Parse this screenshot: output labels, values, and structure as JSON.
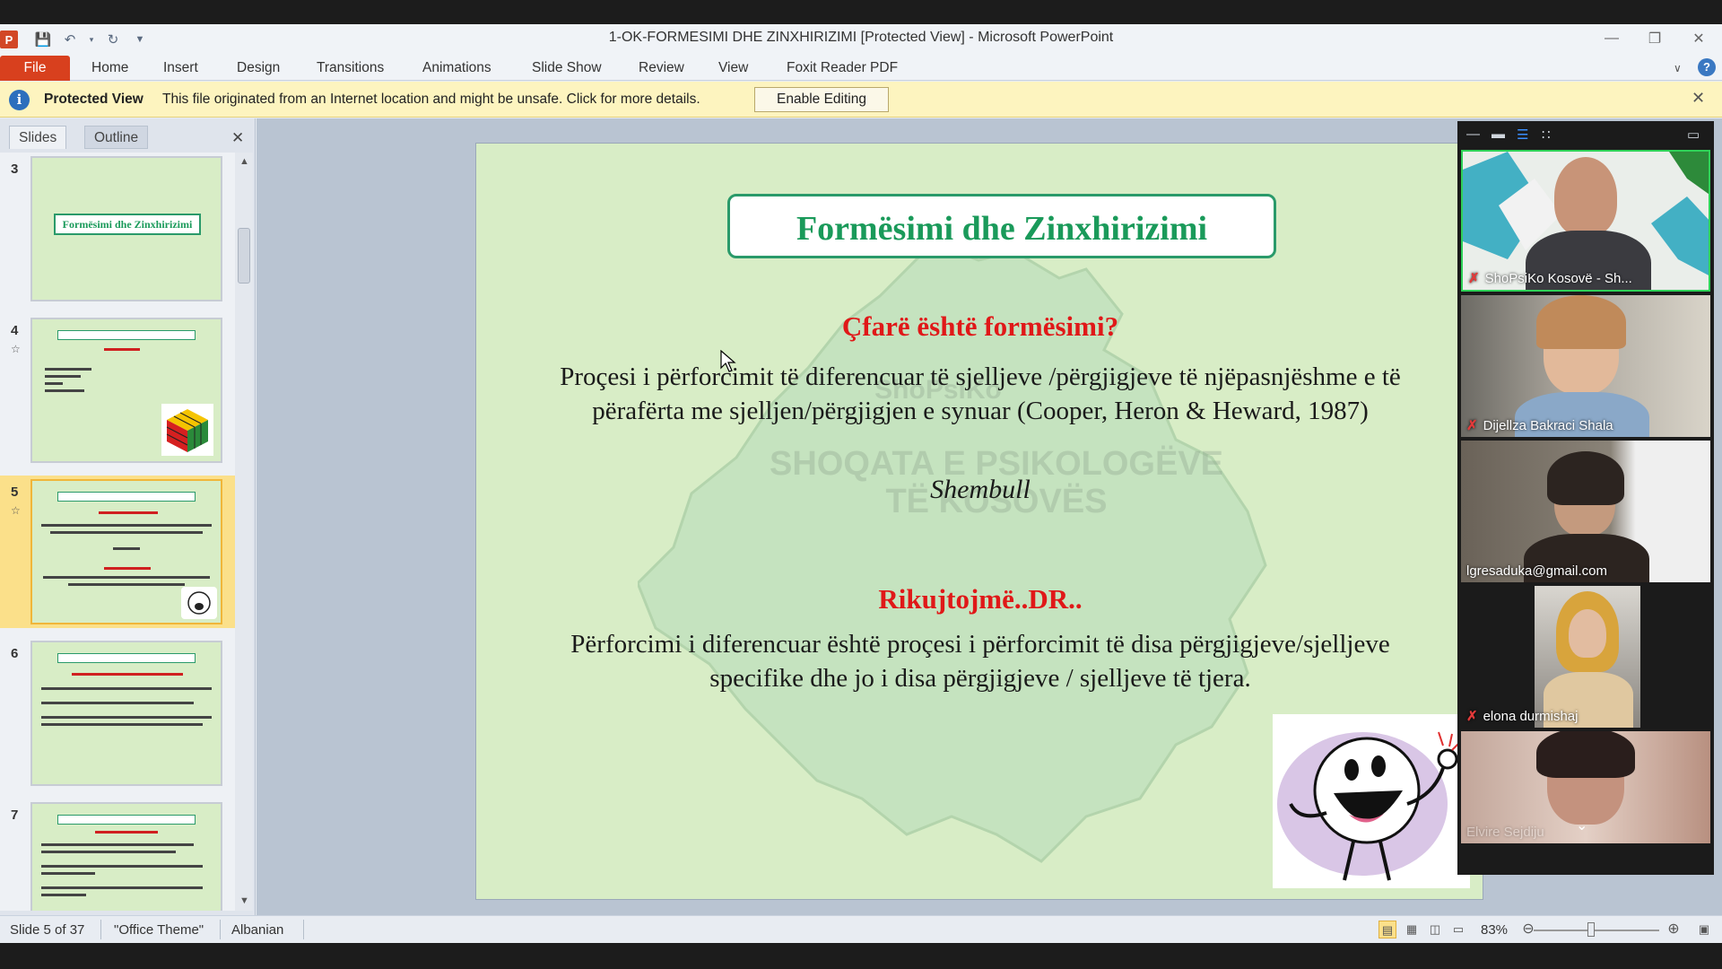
{
  "window": {
    "title": "1-OK-FORMESIMI DHE ZINXHIRIZIMI [Protected View]  -  Microsoft PowerPoint"
  },
  "ribbon": {
    "file_label": "File",
    "tabs": [
      "Home",
      "Insert",
      "Design",
      "Transitions",
      "Animations",
      "Slide Show",
      "Review",
      "View",
      "Foxit Reader PDF"
    ]
  },
  "protected_view": {
    "label": "Protected View",
    "message": "This file originated from an Internet location and might be unsafe. Click for more details.",
    "button": "Enable Editing"
  },
  "left_pane": {
    "tabs": [
      "Slides",
      "Outline"
    ],
    "thumbnails": [
      {
        "number": "3",
        "title": "Formësimi dhe Zinxhirizimi"
      },
      {
        "number": "4"
      },
      {
        "number": "5"
      },
      {
        "number": "6"
      },
      {
        "number": "7"
      }
    ]
  },
  "slide": {
    "title": "Formësimi dhe Zinxhirizimi",
    "question": "Çfarë është formësimi?",
    "definition_line1": "Proçesi i përforcimit të diferencuar të sjelljeve /përgjigjeve të njëpasnjëshme  e të",
    "definition_line2": "përafërta me sjelljen/përgjigjen    e synuar (Cooper, Heron & Heward, 1987)",
    "example_label": "Shembull",
    "reminder_heading": "Rikujtojmë..DR..",
    "reminder_line1": "Përforcimi  i diferencuar është proçesi i përforcimit të disa përgjigjeve/sjelljeve",
    "reminder_line2": "specifike dhe jo i disa përgjigjeve  / sjelljeve të tjera.",
    "watermark_line1": "ShoPsiKo",
    "watermark_line2": "SHOQATA E PSIKOLOGËVE",
    "watermark_line3": "TË KOSOVËS"
  },
  "status_bar": {
    "slide_info": "Slide 5 of 37",
    "theme": "\"Office Theme\"",
    "language": "Albanian",
    "zoom": "83%"
  },
  "video_call": {
    "participants": [
      {
        "name": "ShoPsiKo Kosovë - Sh...",
        "muted": true
      },
      {
        "name": "Dijellza Bakraci Shala",
        "muted": true
      },
      {
        "name": "lgresaduka@gmail.com",
        "muted": false
      },
      {
        "name": "elona durmishaj",
        "muted": true
      },
      {
        "name": "Elvire Sejdiju",
        "muted": false
      }
    ]
  }
}
